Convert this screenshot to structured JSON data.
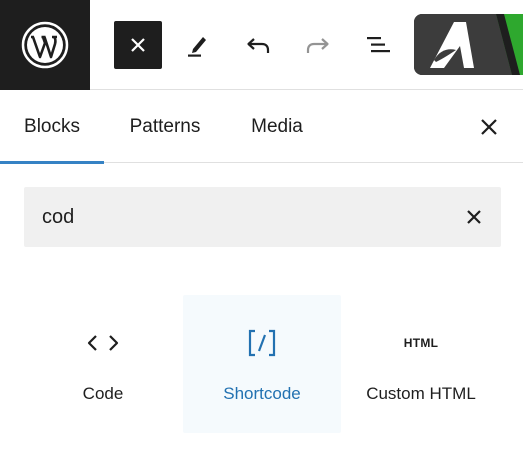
{
  "toolbar": {
    "icons": [
      "wordpress-icon",
      "close-icon",
      "pencil-icon",
      "undo-icon",
      "redo-icon",
      "document-overview-icon",
      "brand-logo-icon"
    ],
    "colors": {
      "dark": "#1e1e1e",
      "disabled": "#949494",
      "brand_bg": "#3c3c3c",
      "brand_green": "#2ea82e"
    }
  },
  "tabs": [
    {
      "label": "Blocks",
      "active": true
    },
    {
      "label": "Patterns",
      "active": false
    },
    {
      "label": "Media",
      "active": false
    }
  ],
  "search": {
    "value": "cod"
  },
  "results": [
    {
      "label": "Code",
      "icon": "code-icon",
      "highlighted": false
    },
    {
      "label": "Shortcode",
      "icon": "shortcode-icon",
      "highlighted": true
    },
    {
      "label": "Custom HTML",
      "icon": "html-icon",
      "icon_text": "HTML",
      "highlighted": false
    }
  ],
  "colors": {
    "accent": "#3582c4",
    "link": "#2271b1",
    "highlight_bg": "#f5fafd",
    "search_bg": "#f0f0f0"
  }
}
